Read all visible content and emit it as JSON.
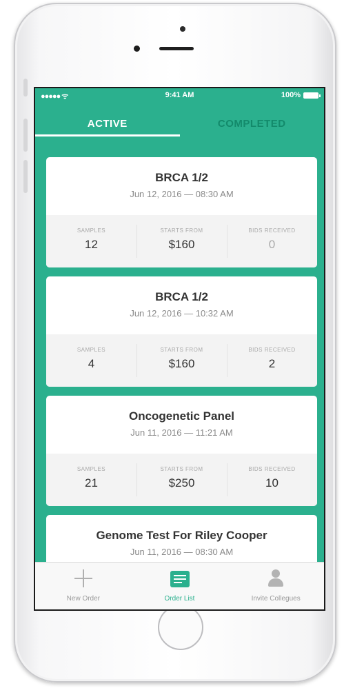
{
  "status_bar": {
    "signal": "●●●●● ",
    "wifi": "ᯤ",
    "time": "9:41 AM",
    "battery": "100%"
  },
  "tabs": [
    {
      "label": "ACTIVE",
      "selected": true
    },
    {
      "label": "COMPLETED",
      "selected": false
    }
  ],
  "orders": [
    {
      "title": "BRCA 1/2",
      "date": "Jun 12, 2016 — 08:30 AM",
      "stats": [
        {
          "label": "SAMPLES",
          "value": "12"
        },
        {
          "label": "STARTS FROM",
          "value": "$160"
        },
        {
          "label": "BIDS RECEIVED",
          "value": "0"
        }
      ]
    },
    {
      "title": "BRCA 1/2",
      "date": "Jun 12, 2016 — 10:32 AM",
      "stats": [
        {
          "label": "SAMPLES",
          "value": "4"
        },
        {
          "label": "STARTS FROM",
          "value": "$160"
        },
        {
          "label": "BIDS RECEIVED",
          "value": "2"
        }
      ]
    },
    {
      "title": "Oncogenetic Panel",
      "date": "Jun 11, 2016 — 11:21 AM",
      "stats": [
        {
          "label": "SAMPLES",
          "value": "21"
        },
        {
          "label": "STARTS FROM",
          "value": "$250"
        },
        {
          "label": "BIDS RECEIVED",
          "value": "10"
        }
      ]
    },
    {
      "title": "Genome Test For Riley Cooper",
      "date": "Jun 11, 2016 — 08:30 AM",
      "stats": []
    }
  ],
  "tab_bar": [
    {
      "label": "New Order",
      "icon": "plus-icon"
    },
    {
      "label": "Order List",
      "icon": "list-icon",
      "selected": true
    },
    {
      "label": "Invite Collegues",
      "icon": "person-icon"
    }
  ],
  "colors": {
    "accent": "#2bb08e",
    "tab_inactive": "#138a6b",
    "card": "#ffffff",
    "stats_bg": "#f3f3f3"
  }
}
